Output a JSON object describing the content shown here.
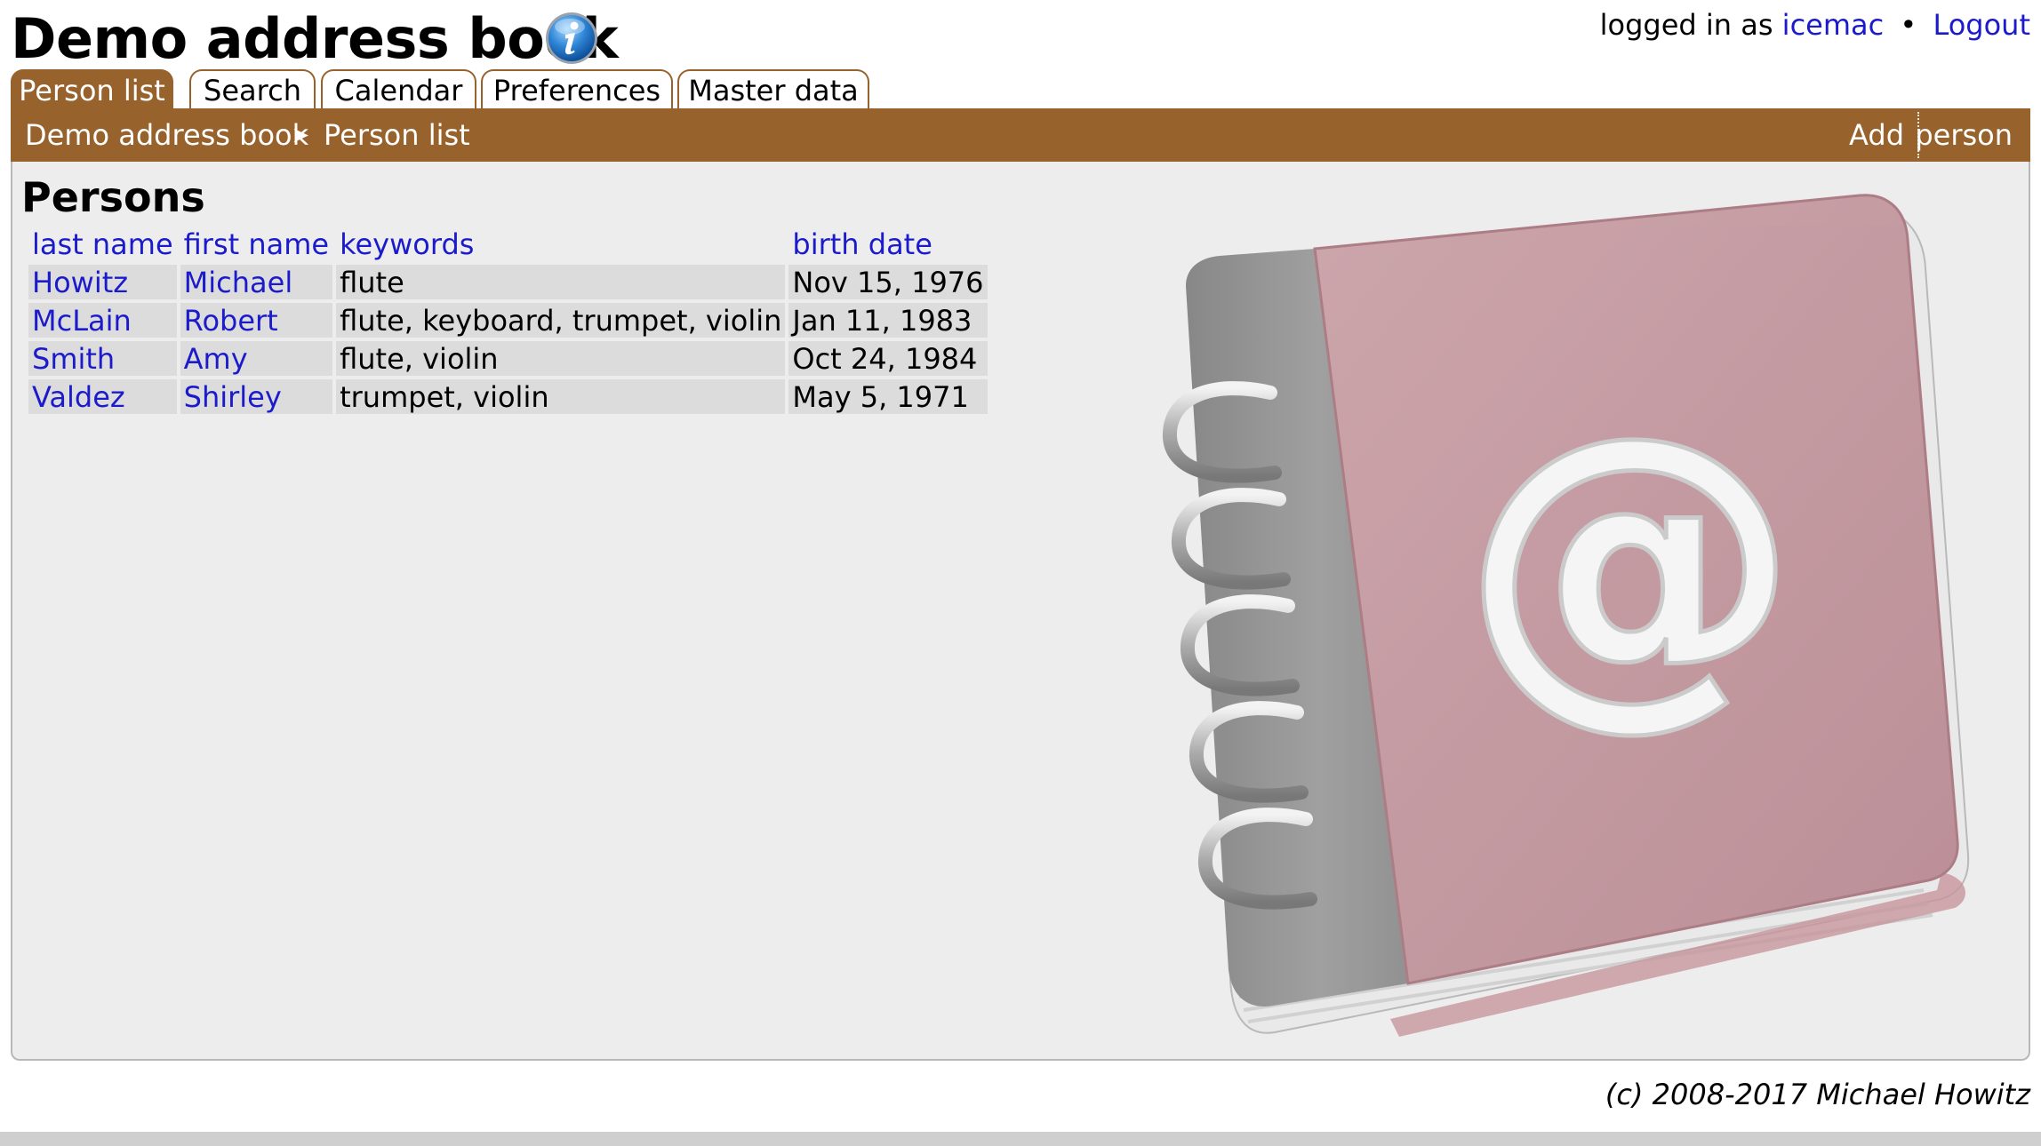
{
  "header": {
    "app_title": "Demo address book",
    "info_icon": "info-icon"
  },
  "user": {
    "logged_in_text": "logged in as",
    "username": "icemac",
    "separator": "•",
    "logout_label": "Logout"
  },
  "tabs": [
    {
      "label": "Person list",
      "active": true
    },
    {
      "label": "Search",
      "active": false
    },
    {
      "label": "Calendar",
      "active": false
    },
    {
      "label": "Preferences",
      "active": false
    },
    {
      "label": "Master data",
      "active": false
    }
  ],
  "breadcrumb": {
    "home": "Demo address book",
    "separator": "➤",
    "current": "Person list"
  },
  "actions": {
    "add_label": "Add",
    "person_label": "person"
  },
  "main": {
    "title": "Persons",
    "columns": [
      "last name",
      "first name",
      "keywords",
      "birth date"
    ],
    "rows": [
      {
        "last_name": "Howitz",
        "first_name": "Michael",
        "keywords": "flute",
        "birth_date": "Nov 15, 1976"
      },
      {
        "last_name": "McLain",
        "first_name": "Robert",
        "keywords": "flute, keyboard, trumpet, violin",
        "birth_date": "Jan 11, 1983"
      },
      {
        "last_name": "Smith",
        "first_name": "Amy",
        "keywords": "flute, violin",
        "birth_date": "Oct 24, 1984"
      },
      {
        "last_name": "Valdez",
        "first_name": "Shirley",
        "keywords": "trumpet, violin",
        "birth_date": "May 5, 1971"
      }
    ]
  },
  "illustration": {
    "icon": "address-book-icon",
    "symbol": "@"
  },
  "footer": {
    "copyright": "(c) 2008-2017 Michael Howitz"
  },
  "colors": {
    "accent": "#98622c",
    "link": "#1b1bcc",
    "content_bg": "#ededed",
    "cell_bg": "#dcdcdc",
    "book_cover": "#bc8e96",
    "book_spine": "#8f8f8f"
  }
}
